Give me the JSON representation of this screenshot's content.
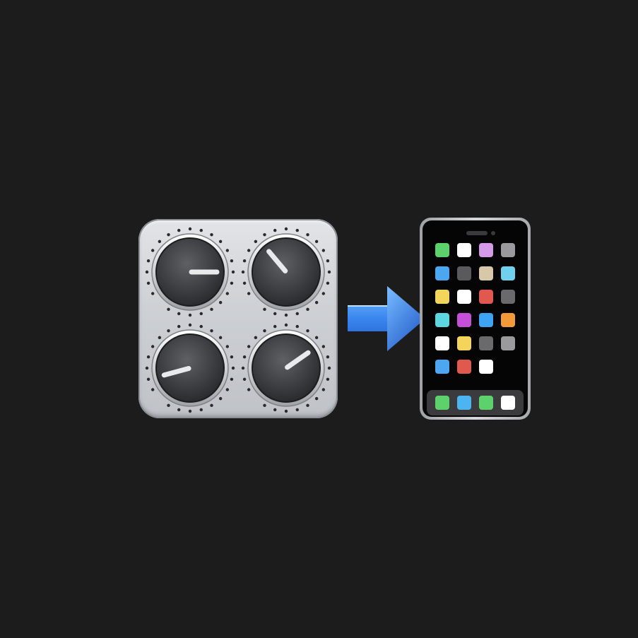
{
  "scene": {
    "background": "#1c1c1c",
    "left_icon": "control-panel-knobs-icon",
    "connector": "right-arrow-icon",
    "right_icon": "mobile-phone-icon"
  },
  "knobs": [
    {
      "name": "knob-top-left",
      "pointer_angle_deg": 0
    },
    {
      "name": "knob-top-right",
      "pointer_angle_deg": -130
    },
    {
      "name": "knob-bottom-left",
      "pointer_angle_deg": 165
    },
    {
      "name": "knob-bottom-right",
      "pointer_angle_deg": -35
    }
  ],
  "arrow": {
    "color_light": "#6fb4ff",
    "color_dark": "#1f5fd1"
  },
  "phone": {
    "home_apps": [
      "#5dd16b",
      "#ffffff",
      "#d39be8",
      "#9a9a9c",
      "#4da6f2",
      "#5a5a5c",
      "#d8c7a8",
      "#6fd1ec",
      "#f4d55c",
      "#ffffff",
      "#e0584e",
      "#6a6a6c",
      "#5cd6e0",
      "#c54fd6",
      "#3ea3f2",
      "#f29a3a",
      "#ffffff",
      "#f4d55c",
      "#6a6a6c",
      "#9a9a9c",
      "#4da6f2",
      "#e0584e",
      "#ffffff"
    ],
    "dock_apps": [
      "#5dd16b",
      "#4db4f2",
      "#5dd16b",
      "#ffffff"
    ]
  }
}
